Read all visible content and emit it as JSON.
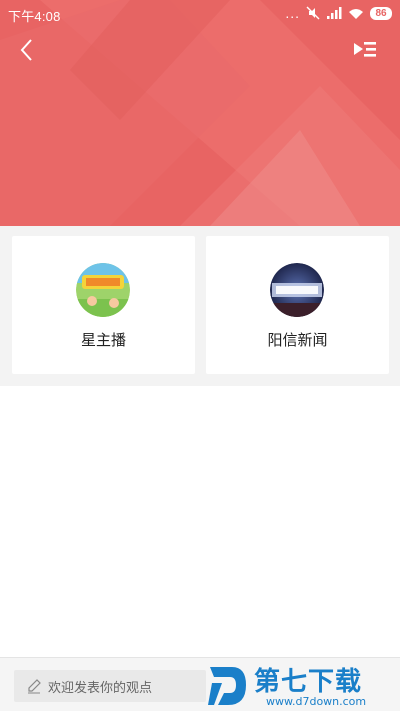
{
  "status_bar": {
    "time": "下午4:08",
    "dots": "...",
    "battery": "86"
  },
  "header": {
    "back_icon": "chevron-left-icon",
    "menu_icon": "playlist-icon",
    "background_color": "#e86463"
  },
  "channels": [
    {
      "name": "星主播",
      "avatar": "xingzhubo-logo"
    },
    {
      "name": "阳信新闻",
      "avatar": "yangxin-news-logo"
    }
  ],
  "comment_bar": {
    "placeholder": "欢迎发表你的观点",
    "icon": "pencil-icon"
  },
  "watermark": {
    "brand": "第七下载",
    "url": "www.d7down.com",
    "color": "#1a7fc9"
  }
}
